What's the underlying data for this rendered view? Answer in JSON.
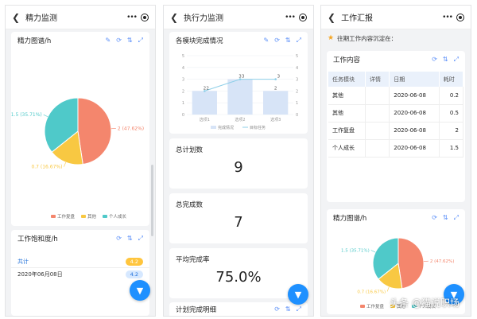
{
  "phone1": {
    "nav_title": "精力监测",
    "card_title": "精力图谱/h",
    "pie": {
      "labels": [
        "2 (47.62%)",
        "0.7 (16.67%)",
        "1.5 (35.71%)"
      ],
      "values": [
        2,
        0.7,
        1.5
      ],
      "colors": [
        "#f4866d",
        "#f8c842",
        "#4fc9c9"
      ],
      "legend": [
        "工作复盘",
        "其他",
        "个人成长"
      ]
    },
    "card2_title": "工作饱和度/h",
    "rows": [
      {
        "label": "共计",
        "value": "4.2"
      },
      {
        "label": "2020年06月08日",
        "value": "4.2"
      }
    ]
  },
  "phone2": {
    "nav_title": "执行力监测",
    "chart_title": "各模块完成情况",
    "chart_data": {
      "type": "bar",
      "categories": [
        "选项1",
        "选项2",
        "选项3"
      ],
      "series": [
        {
          "name": "完成情况",
          "values": [
            2,
            3,
            2
          ]
        },
        {
          "name": "目标任务",
          "values": [
            2,
            3,
            3
          ]
        }
      ],
      "y_left_ticks": [
        "0",
        "1",
        "2",
        "3",
        "4",
        "5"
      ],
      "y_right_ticks": [
        "0",
        "1",
        "2",
        "3",
        "4",
        "5"
      ],
      "ylim": [
        0,
        5
      ]
    },
    "stats": [
      {
        "label": "总计划数",
        "value": "9"
      },
      {
        "label": "总完成数",
        "value": "7"
      },
      {
        "label": "平均完成率",
        "value": "75.0%"
      }
    ],
    "bottom_title": "计划完成明细"
  },
  "phone3": {
    "nav_title": "工作汇报",
    "notice": "往期工作内容沉淀在：",
    "table_title": "工作内容",
    "headers": [
      "任务模块",
      "详情",
      "日期",
      "耗时"
    ],
    "rows": [
      [
        "其他",
        "",
        "2020-06-08",
        "0.2"
      ],
      [
        "其他",
        "",
        "2020-06-08",
        "0.5"
      ],
      [
        "工作复盘",
        "",
        "2020-06-08",
        "2"
      ],
      [
        "个人成长",
        "",
        "2020-06-08",
        "1.5"
      ]
    ],
    "card2_title": "精力图谱/h",
    "pie": {
      "labels": [
        "2 (47.62%)",
        "0.7 (16.67%)",
        "1.5 (35.71%)"
      ],
      "values": [
        2,
        0.7,
        1.5
      ],
      "colors": [
        "#f4866d",
        "#f8c842",
        "#4fc9c9"
      ],
      "legend": [
        "工作复盘",
        "其他",
        "个人成长"
      ]
    }
  },
  "watermark": "头条 @猫说职场",
  "icons": [
    "back-icon",
    "more-icon",
    "record-icon",
    "edit-icon",
    "refresh-icon",
    "sort-icon",
    "expand-icon",
    "filter-icon",
    "star-icon"
  ]
}
